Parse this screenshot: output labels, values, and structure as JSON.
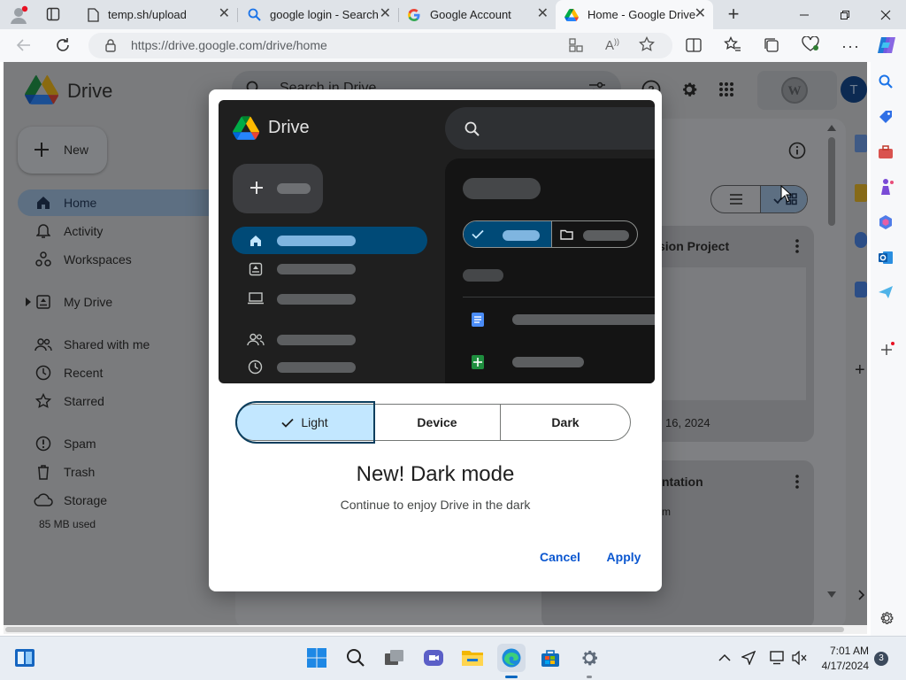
{
  "browser": {
    "tabs": [
      {
        "title": "temp.sh/upload",
        "icon": "page-icon"
      },
      {
        "title": "google login - Search",
        "icon": "search-icon"
      },
      {
        "title": "Google Account",
        "icon": "google-icon"
      },
      {
        "title": "Home - Google Drive",
        "icon": "drive-icon",
        "active": true
      }
    ],
    "url": "https://drive.google.com/drive/home"
  },
  "drive": {
    "app_name": "Drive",
    "search_placeholder": "Search in Drive",
    "new_label": "New",
    "nav": [
      {
        "label": "Home",
        "icon": "home-icon",
        "active": true
      },
      {
        "label": "Activity",
        "icon": "bell-icon"
      },
      {
        "label": "Workspaces",
        "icon": "workspaces-icon"
      },
      {
        "label": "My Drive",
        "icon": "my-drive-icon"
      },
      {
        "label": "Shared with me",
        "icon": "people-icon"
      },
      {
        "label": "Recent",
        "icon": "clock-icon"
      },
      {
        "label": "Starred",
        "icon": "star-icon"
      },
      {
        "label": "Spam",
        "icon": "spam-icon"
      },
      {
        "label": "Trash",
        "icon": "trash-icon"
      },
      {
        "label": "Storage",
        "icon": "cloud-icon"
      }
    ],
    "storage_used": "85 MB used",
    "avatar_letter": "T",
    "cards": [
      {
        "title_fragment": "sion Project",
        "date_fragment": "16, 2024"
      },
      {
        "title_fragment": "ntation",
        "subtitle_fragment": "m"
      }
    ]
  },
  "modal": {
    "preview": {
      "app_name": "Drive"
    },
    "theme_options": [
      "Light",
      "Device",
      "Dark"
    ],
    "selected_theme": "Light",
    "title": "New! Dark mode",
    "subtitle": "Continue to enjoy Drive in the dark",
    "cancel_label": "Cancel",
    "apply_label": "Apply"
  },
  "taskbar": {
    "time": "7:01 AM",
    "date": "4/17/2024",
    "notification_count": "3"
  },
  "colors": {
    "accent": "#0b57d0",
    "selected_bg": "#c2e7ff",
    "dark_preview_bg": "#1f1f1f"
  }
}
